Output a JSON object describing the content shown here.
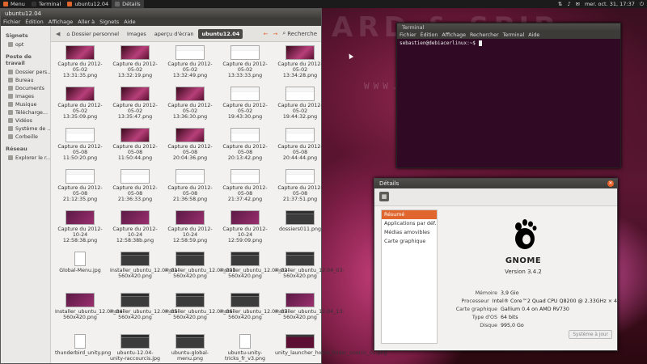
{
  "panel": {
    "menu": "Menu",
    "tabs": [
      {
        "label": "Terminal",
        "active": false
      },
      {
        "label": "ubuntu12.04",
        "active": false
      },
      {
        "label": "Détails",
        "active": true
      }
    ],
    "clock": "mer. oct. 31, 17:37"
  },
  "wallpaper": {
    "big_text": "ARD & SPIP",
    "small_text": "WWW.7ALSB.COM"
  },
  "nautilus": {
    "title": "ubuntu12.04",
    "menu": [
      "Fichier",
      "Édition",
      "Affichage",
      "Aller à",
      "Signets",
      "Aide"
    ],
    "sidebar": [
      {
        "heading": "Signets",
        "items": [
          "opt"
        ]
      },
      {
        "heading": "Poste de travail",
        "items": [
          "Dossier pers...",
          "Bureau",
          "Documents",
          "Images",
          "Musique",
          "Télécharge...",
          "Vidéos",
          "Système de ...",
          "Corbeille"
        ]
      },
      {
        "heading": "Réseau",
        "items": [
          "Explorer le r..."
        ]
      }
    ],
    "breadcrumbs": [
      "Dossier personnel",
      "Images",
      "aperçu d'écran",
      "ubuntu12.04"
    ],
    "search_label": "Recherche",
    "files": [
      {
        "name": "Capture du 2012-05-02 13:31:35.png",
        "thumb": "pink"
      },
      {
        "name": "Capture du 2012-05-02 13:32:19.png",
        "thumb": "pink"
      },
      {
        "name": "Capture du 2012-05-02 13:32:49.png",
        "thumb": "light"
      },
      {
        "name": "Capture du 2012-05-02 13:33:33.png",
        "thumb": "light"
      },
      {
        "name": "Capture du 2012-05-02 13:34:28.png",
        "thumb": "pink"
      },
      {
        "name": "Capture du 2012-05-02 13:35:09.png",
        "thumb": "pink"
      },
      {
        "name": "Capture du 2012-05-02 13:35:47.png",
        "thumb": "pink"
      },
      {
        "name": "Capture du 2012-05-02 13:36:30.png",
        "thumb": "pink"
      },
      {
        "name": "Capture du 2012-05-02 19:43:30.png",
        "thumb": "light"
      },
      {
        "name": "Capture du 2012-05-02 19:44:32.png",
        "thumb": "light"
      },
      {
        "name": "Capture du 2012-05-08 11:50:20.png",
        "thumb": "light"
      },
      {
        "name": "Capture du 2012-05-08 11:50:44.png",
        "thumb": "pink"
      },
      {
        "name": "Capture du 2012-05-08 20:04:36.png",
        "thumb": "pink"
      },
      {
        "name": "Capture du 2012-05-08 20:13:42.png",
        "thumb": "light"
      },
      {
        "name": "Capture du 2012-05-08 20:44:44.png",
        "thumb": "light"
      },
      {
        "name": "Capture du 2012-05-08 21:12:35.png",
        "thumb": "light"
      },
      {
        "name": "Capture du 2012-05-08 21:36:33.png",
        "thumb": "light"
      },
      {
        "name": "Capture du 2012-05-08 21:36:58.png",
        "thumb": "light"
      },
      {
        "name": "Capture du 2012-05-08 21:37:42.png",
        "thumb": "light"
      },
      {
        "name": "Capture du 2012-05-08 21:37:51.png",
        "thumb": "light"
      },
      {
        "name": "Capture du 2012-10-24 12:58:38.png",
        "thumb": "purple"
      },
      {
        "name": "Capture du 2012-10-24 12:58:38b.png",
        "thumb": "purple"
      },
      {
        "name": "Capture du 2012-10-24 12:58:59.png",
        "thumb": "purple"
      },
      {
        "name": "Capture du 2012-10-24 12:59:09.png",
        "thumb": "purple"
      },
      {
        "name": "dossiers011.png",
        "thumb": "dark"
      },
      {
        "name": "Global-Menu.jpg",
        "thumb": "doc"
      },
      {
        "name": "Installer_ubuntu_12.04_01-560x420.png",
        "thumb": "dark"
      },
      {
        "name": "Installer_ubuntu_12.04_001-560x420.png",
        "thumb": "dark"
      },
      {
        "name": "Installer_ubuntu_12.04_02-560x420.png",
        "thumb": "dark"
      },
      {
        "name": "Installer_ubuntu_12.04_03-560x420.png",
        "thumb": "dark"
      },
      {
        "name": "Installer_ubuntu_12.04_04-560x420.png",
        "thumb": "purple"
      },
      {
        "name": "Installer_ubuntu_12.04_05-560x420.png",
        "thumb": "dark"
      },
      {
        "name": "Installer_ubuntu_12.04_06-560x420.png",
        "thumb": "dark"
      },
      {
        "name": "Installer_ubuntu_12.04_07-560x420.png",
        "thumb": "dark"
      },
      {
        "name": "Installer_ubuntu_12.04_13-560x420.png",
        "thumb": "purple"
      },
      {
        "name": "thunderbird_unity.png",
        "thumb": "doc"
      },
      {
        "name": "ubuntu-12.04-unity-raccourcis.jpg",
        "thumb": "dark"
      },
      {
        "name": "ubuntu-global-menu.png",
        "thumb": "dark"
      },
      {
        "name": "ubuntu-unity-tricks_fr_v3.png",
        "thumb": "doc"
      },
      {
        "name": "unity_launcher_home_folder_oneiric_01.png",
        "thumb": "term"
      }
    ]
  },
  "terminal": {
    "title": "Terminal",
    "menu": [
      "Fichier",
      "Édition",
      "Affichage",
      "Rechercher",
      "Terminal",
      "Aide"
    ],
    "prompt": "sebastien@debiacerlinux:~$ "
  },
  "details": {
    "title": "Détails",
    "sections": [
      "Résumé",
      "Applications par déf...",
      "Médias amovibles",
      "Carte graphique"
    ],
    "selected_section": 0,
    "logo_text": "GNOME",
    "version": "Version 3.4.2",
    "info": [
      {
        "key": "Mémoire",
        "value": "3,9 Gio"
      },
      {
        "key": "Processeur",
        "value": "Intel® Core™2 Quad CPU Q8200 @ 2.33GHz × 4"
      },
      {
        "key": "Carte graphique",
        "value": "Gallium 0.4 on AMD RV730"
      },
      {
        "key": "Type d'OS",
        "value": "64 bits"
      },
      {
        "key": "Disque",
        "value": "995,0 Go"
      }
    ],
    "update_button": "Système à jour"
  }
}
